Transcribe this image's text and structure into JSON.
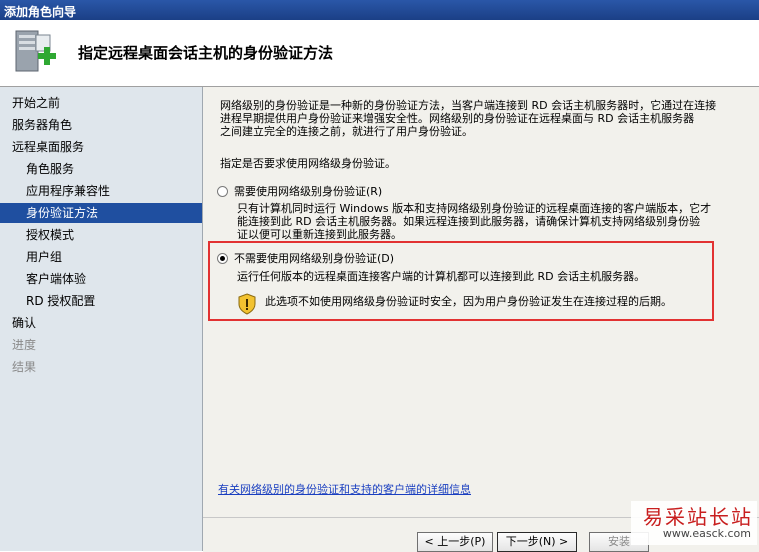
{
  "window": {
    "title": "添加角色向导"
  },
  "header": {
    "title": "指定远程桌面会话主机的身份验证方法",
    "icon": "server-add-icon"
  },
  "sidebar": {
    "items": [
      {
        "label": "开始之前",
        "state": "normal",
        "indent": 0
      },
      {
        "label": "服务器角色",
        "state": "normal",
        "indent": 0
      },
      {
        "label": "远程桌面服务",
        "state": "normal",
        "indent": 0
      },
      {
        "label": "角色服务",
        "state": "normal",
        "indent": 1
      },
      {
        "label": "应用程序兼容性",
        "state": "normal",
        "indent": 1
      },
      {
        "label": "身份验证方法",
        "state": "active",
        "indent": 1
      },
      {
        "label": "授权模式",
        "state": "normal",
        "indent": 1
      },
      {
        "label": "用户组",
        "state": "normal",
        "indent": 1
      },
      {
        "label": "客户端体验",
        "state": "normal",
        "indent": 1
      },
      {
        "label": "RD 授权配置",
        "state": "normal",
        "indent": 1
      },
      {
        "label": "确认",
        "state": "normal",
        "indent": 0
      },
      {
        "label": "进度",
        "state": "disabled",
        "indent": 0
      },
      {
        "label": "结果",
        "state": "disabled",
        "indent": 0
      }
    ]
  },
  "main": {
    "intro_line1": "网络级别的身份验证是一种新的身份验证方法，当客户端连接到 RD 会话主机服务器时，它通过在连接",
    "intro_line2": "进程早期提供用户身份验证来增强安全性。网络级别的身份验证在远程桌面与 RD 会话主机服务器",
    "intro_line3": "之间建立完全的连接之前，就进行了用户身份验证。",
    "question": "指定是否要求使用网络级身份验证。",
    "option1": {
      "label": "需要使用网络级别身份验证(R)",
      "selected": false,
      "desc_line1": "只有计算机同时运行 Windows 版本和支持网络级别身份验证的远程桌面连接的客户端版本，它才",
      "desc_line2": "能连接到此 RD 会话主机服务器。如果远程连接到此服务器，请确保计算机支持网络级别身份验",
      "desc_line3": "证以便可以重新连接到此服务器。"
    },
    "option2": {
      "label": "不需要使用网络级别身份验证(D)",
      "selected": true,
      "desc": "运行任何版本的远程桌面连接客户端的计算机都可以连接到此 RD 会话主机服务器。",
      "warning": "此选项不如使用网络级身份验证时安全，因为用户身份验证发生在连接过程的后期。",
      "warning_icon": "shield-warning-icon"
    },
    "link": "有关网络级别的身份验证和支持的客户端的详细信息"
  },
  "footer": {
    "back": "< 上一步(P)",
    "next": "下一步(N) >",
    "install": "安装"
  },
  "watermark": {
    "line1": "易采站长站",
    "line2": "www.easck.com"
  }
}
